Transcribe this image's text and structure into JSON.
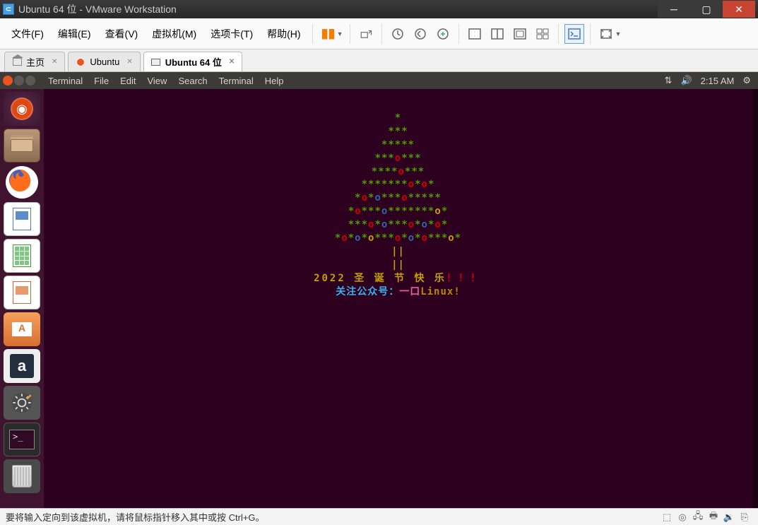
{
  "titlebar": {
    "title": "Ubuntu 64 位 - VMware Workstation"
  },
  "menubar": {
    "items": [
      "文件(F)",
      "编辑(E)",
      "查看(V)",
      "虚拟机(M)",
      "选项卡(T)",
      "帮助(H)"
    ]
  },
  "tabs": {
    "home": "主页",
    "ubuntu": "Ubuntu",
    "ubuntu64": "Ubuntu 64 位"
  },
  "ubuntu_menu": {
    "items": [
      "Terminal",
      "File",
      "Edit",
      "View",
      "Search",
      "Terminal",
      "Help"
    ],
    "time": "2:15 AM"
  },
  "terminal": {
    "message_year": "2022",
    "message_cn": "圣 诞 节 快 乐",
    "message_ex": "！！！",
    "follow_label": "关注公众号：",
    "follow_name": "一口",
    "follow_suffix": "Linux!"
  },
  "statusbar": {
    "hint": "要将输入定向到该虚拟机，请将鼠标指针移入其中或按 Ctrl+G。"
  }
}
